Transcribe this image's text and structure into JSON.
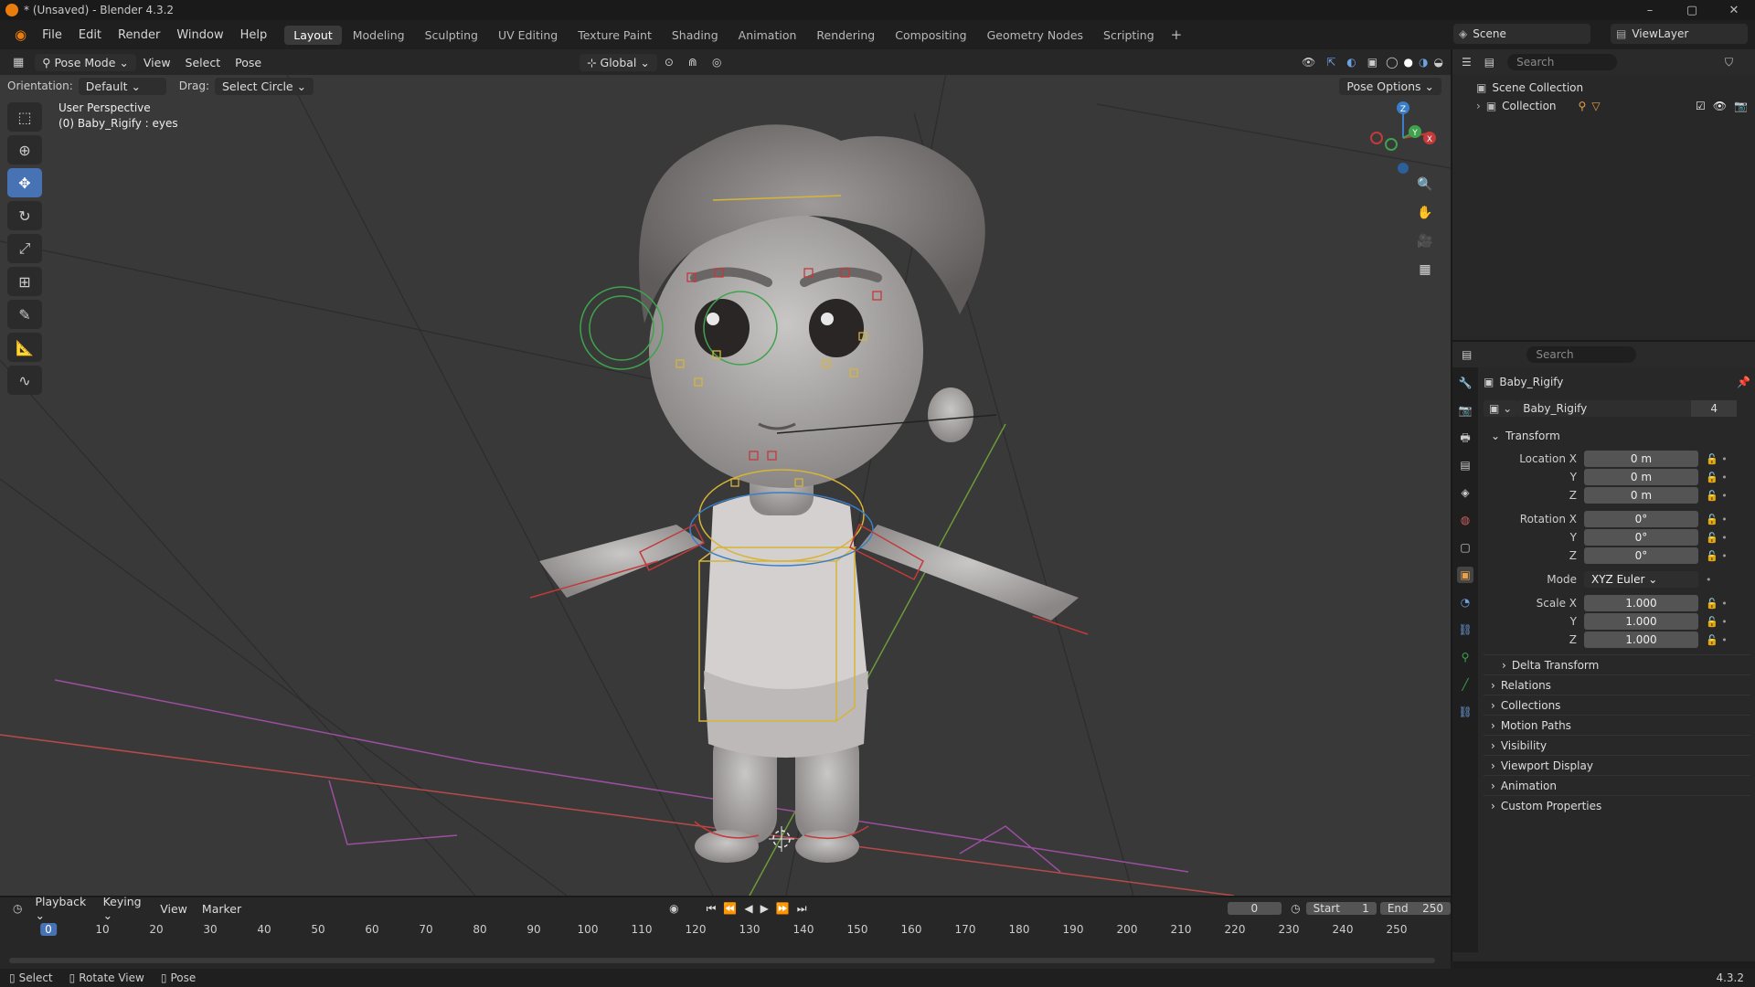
{
  "window": {
    "title": "* (Unsaved) - Blender 4.3.2"
  },
  "menu": [
    "File",
    "Edit",
    "Render",
    "Window",
    "Help"
  ],
  "workspaces": [
    "Layout",
    "Modeling",
    "Sculpting",
    "UV Editing",
    "Texture Paint",
    "Shading",
    "Animation",
    "Rendering",
    "Compositing",
    "Geometry Nodes",
    "Scripting"
  ],
  "workspace_add": "+",
  "scene": {
    "name": "Scene",
    "view_layer": "ViewLayer"
  },
  "viewport_header": {
    "mode": "Pose Mode",
    "menus": [
      "View",
      "Select",
      "Pose"
    ],
    "transform_orientation": "Global",
    "orientation_label": "Orientation:",
    "orientation_value": "Default",
    "drag_label": "Drag:",
    "drag_value": "Select Circle",
    "pose_options": "Pose Options"
  },
  "viewport": {
    "perspective": "User Perspective",
    "active": "(0) Baby_Rigify : eyes",
    "gizmo": {
      "z": "Z",
      "x": "X",
      "y": "Y"
    }
  },
  "outliner": {
    "search_placeholder": "Search",
    "rows": [
      {
        "label": "Scene Collection"
      },
      {
        "label": "Collection"
      }
    ]
  },
  "properties": {
    "search_placeholder": "Search",
    "object_name": "Baby_Rigify",
    "data_name": "Baby_Rigify",
    "users": "4",
    "transform_title": "Transform",
    "location": {
      "label": "Location X",
      "x": "0 m",
      "y": "0 m",
      "z": "0 m"
    },
    "rotation": {
      "label": "Rotation X",
      "x": "0°",
      "y": "0°",
      "z": "0°"
    },
    "mode_label": "Mode",
    "mode_value": "XYZ Euler",
    "scale": {
      "label": "Scale X",
      "x": "1.000",
      "y": "1.000",
      "z": "1.000"
    },
    "axis_y": "Y",
    "axis_z": "Z",
    "delta_transform": "Delta Transform",
    "panels": [
      "Relations",
      "Collections",
      "Motion Paths",
      "Visibility",
      "Viewport Display",
      "Animation",
      "Custom Properties"
    ]
  },
  "timeline": {
    "menus": [
      "Playback",
      "Keying",
      "View",
      "Marker"
    ],
    "current_frame": "0",
    "start_label": "Start",
    "start": "1",
    "end_label": "End",
    "end": "250",
    "ruler": [
      "0",
      "10",
      "20",
      "30",
      "40",
      "50",
      "60",
      "70",
      "80",
      "90",
      "100",
      "110",
      "120",
      "130",
      "140",
      "150",
      "160",
      "170",
      "180",
      "190",
      "200",
      "210",
      "220",
      "230",
      "240",
      "250"
    ]
  },
  "statusbar": {
    "items": [
      "Select",
      "Rotate View",
      "Pose"
    ],
    "version": "4.3.2"
  },
  "colors": {
    "accent": "#4772b3",
    "active_frame": "#4772b3",
    "pose_bone_yellow": "#d6b437",
    "pose_bone_red": "#c23a3a",
    "pose_bone_green": "#3fa34d"
  }
}
